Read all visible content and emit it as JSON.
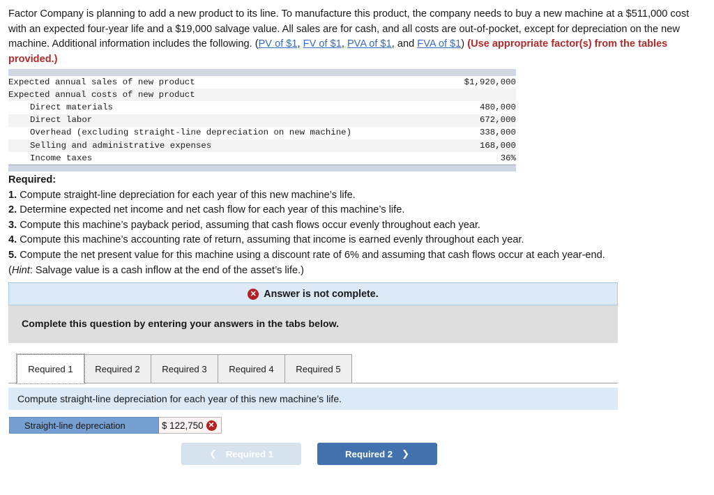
{
  "intro": {
    "part1": "Factor Company is planning to add a new product to its line. To manufacture this product, the company needs to buy a new machine at a $511,000 cost with an expected four-year life and a $19,000 salvage value. All sales are for cash, and all costs are out-of-pocket, except for depreciation on the new machine. Additional information includes the following. (",
    "link1": "PV of $1",
    "sep1": ", ",
    "link2": "FV of $1",
    "sep2": ", ",
    "link3": "PVA of $1",
    "sep3": ", and ",
    "link4": "FVA of $1",
    "part2": ") ",
    "red_note": "(Use appropriate factor(s) from the tables provided.)"
  },
  "data_table": {
    "rows": [
      {
        "label": "Expected annual sales of new product",
        "indent": false,
        "value": "$1,920,000"
      },
      {
        "label": "Expected annual costs of new product",
        "indent": false,
        "value": ""
      },
      {
        "label": "Direct materials",
        "indent": true,
        "value": "480,000"
      },
      {
        "label": "Direct labor",
        "indent": true,
        "value": "672,000"
      },
      {
        "label": "Overhead (excluding straight-line depreciation on new machine)",
        "indent": true,
        "value": "338,000"
      },
      {
        "label": "Selling and administrative expenses",
        "indent": true,
        "value": "168,000"
      },
      {
        "label": "Income taxes",
        "indent": true,
        "value": "36%"
      }
    ]
  },
  "required": {
    "heading": "Required:",
    "items": [
      {
        "num": "1.",
        "text": " Compute straight-line depreciation for each year of this new machine’s life."
      },
      {
        "num": "2.",
        "text": " Determine expected net income and net cash flow for each year of this machine’s life."
      },
      {
        "num": "3.",
        "text": " Compute this machine’s payback period, assuming that cash flows occur evenly throughout each year."
      },
      {
        "num": "4.",
        "text": " Compute this machine’s accounting rate of return, assuming that income is earned evenly throughout each year."
      },
      {
        "num": "5.",
        "text": " Compute the net present value for this machine using a discount rate of 6% and assuming that cash flows occur at each year-end."
      }
    ],
    "hint_open": "(",
    "hint_italic": "Hint",
    "hint_rest": ": Salvage value is a cash inflow at the end of the asset’s life.)"
  },
  "answer_panel": {
    "status_icon": "error-x-icon",
    "status_text": "Answer is not complete.",
    "instruction": "Complete this question by entering your answers in the tabs below.",
    "tabs": [
      {
        "label": "Required 1",
        "active": true
      },
      {
        "label": "Required 2",
        "active": false
      },
      {
        "label": "Required 3",
        "active": false
      },
      {
        "label": "Required 4",
        "active": false
      },
      {
        "label": "Required 5",
        "active": false
      }
    ],
    "prompt": "Compute straight-line depreciation for each year of this new machine’s life.",
    "answer_row": {
      "label": "Straight-line depreciation",
      "value": "$ 122,750",
      "validation_icon": "error-x-icon"
    },
    "nav": {
      "prev_label": "Required 1",
      "prev_icon": "chevron-left-icon",
      "next_label": "Required 2",
      "next_icon": "chevron-right-icon"
    }
  },
  "colors": {
    "link_blue": "#3a6bbd",
    "red_note": "#b02b2b",
    "panel_blue": "#dce9f7",
    "gray_bar": "#dedede",
    "answer_label_blue": "#76a0d1",
    "next_button_blue": "#4172ad",
    "prev_button_blue": "#d7e2ef",
    "error_red": "#b32222",
    "table_bar": "#ced7e3"
  }
}
